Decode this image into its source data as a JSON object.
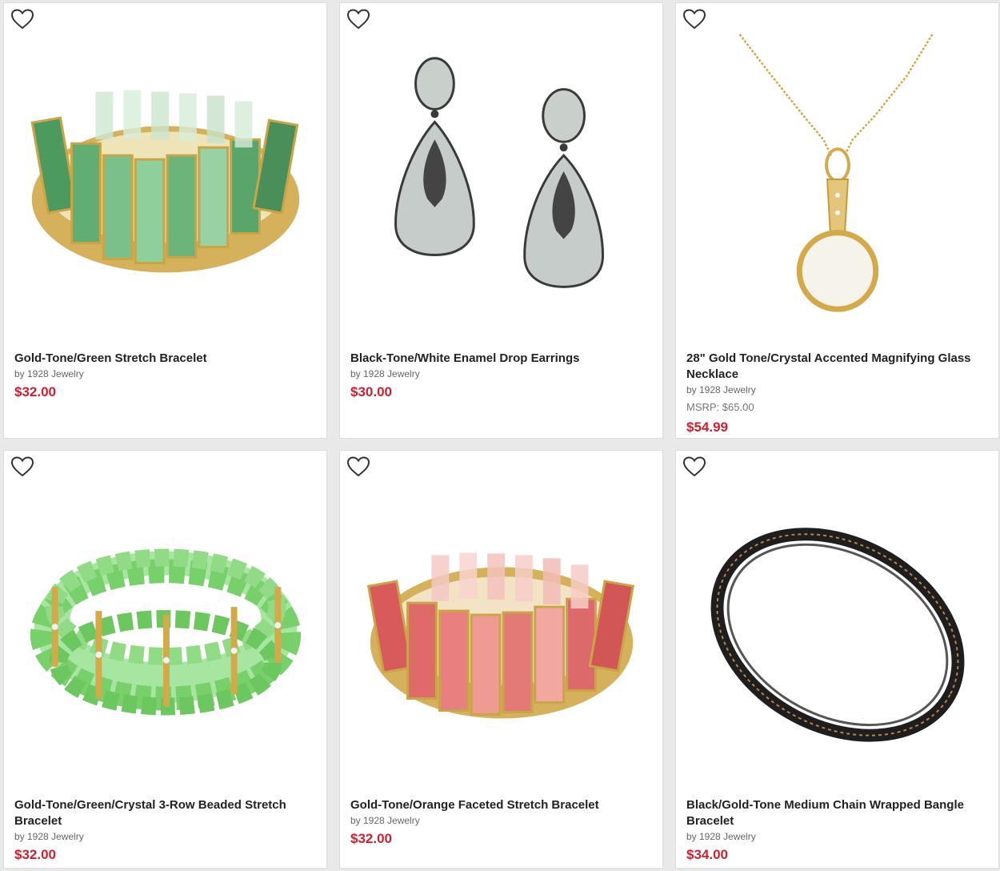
{
  "products": [
    {
      "title": "Gold-Tone/Green Stretch Bracelet",
      "brand": "by 1928 Jewelry",
      "price": "$32.00"
    },
    {
      "title": "Black-Tone/White Enamel Drop Earrings",
      "brand": "by 1928 Jewelry",
      "price": "$30.00"
    },
    {
      "title": "28\" Gold Tone/Crystal Accented Magnifying Glass Necklace",
      "brand": "by 1928 Jewelry",
      "msrp": "MSRP: $65.00",
      "price": "$54.99"
    },
    {
      "title": "Gold-Tone/Green/Crystal 3-Row Beaded Stretch Bracelet",
      "brand": "by 1928 Jewelry",
      "price": "$32.00"
    },
    {
      "title": "Gold-Tone/Orange Faceted Stretch Bracelet",
      "brand": "by 1928 Jewelry",
      "price": "$32.00"
    },
    {
      "title": "Black/Gold-Tone Medium Chain Wrapped Bangle Bracelet",
      "brand": "by 1928 Jewelry",
      "price": "$34.00"
    }
  ],
  "colors": {
    "price": "#d0202e",
    "title": "#222222",
    "card_border": "#dcdcdc",
    "background": "#e9e9e9"
  },
  "icons": {
    "wishlist": "heart-outline-icon"
  }
}
